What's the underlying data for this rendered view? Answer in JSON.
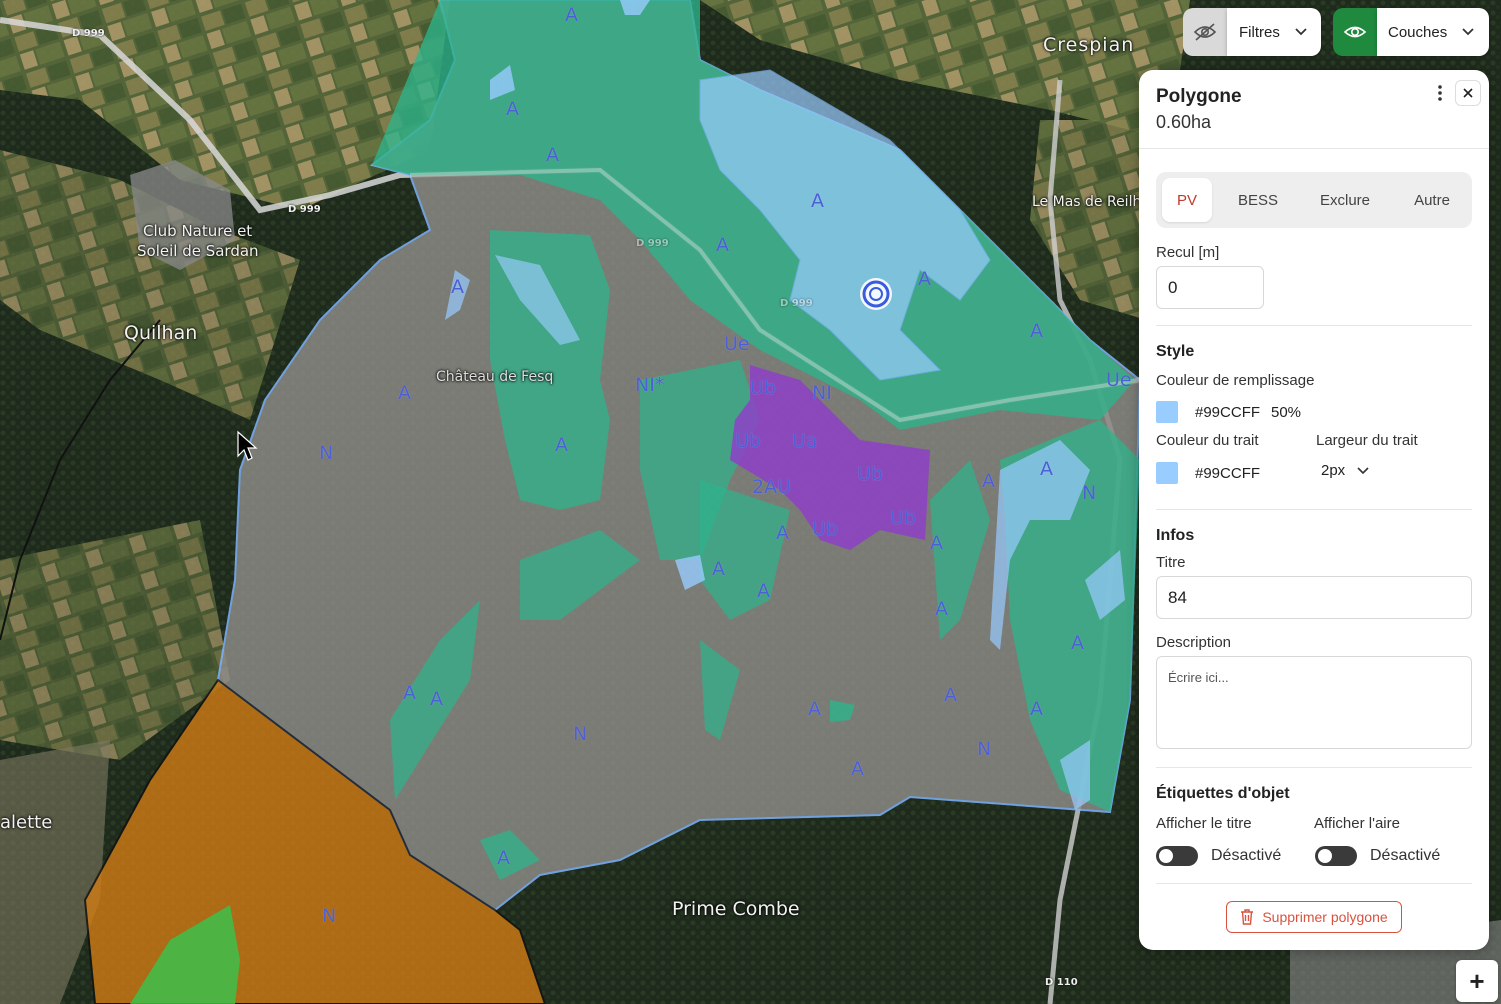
{
  "map": {
    "places": [
      {
        "id": "crespian",
        "name": "Crespian"
      },
      {
        "id": "club",
        "name": "Club Nature et"
      },
      {
        "id": "club2",
        "name": "Soleil de Sardan"
      },
      {
        "id": "quilhan",
        "name": "Quilhan"
      },
      {
        "id": "chateau",
        "name": "Château de Fesq"
      },
      {
        "id": "masreilh",
        "name": "Le Mas de Reilh"
      },
      {
        "id": "primecombe",
        "name": "Prime Combe"
      },
      {
        "id": "alette",
        "name": "alette"
      }
    ],
    "roads": [
      "D 999",
      "D 999",
      "D 999",
      "D 999",
      "D 110"
    ],
    "zones": [
      "A",
      "A",
      "A",
      "A",
      "A",
      "A",
      "A",
      "A",
      "A",
      "A",
      "A",
      "A",
      "A",
      "A",
      "A",
      "A",
      "A",
      "A",
      "A",
      "A",
      "A",
      "A",
      "A",
      "A",
      "N",
      "N",
      "N",
      "N",
      "N",
      "Ue",
      "Ue",
      "NI*",
      "NI",
      "Ub",
      "Ub",
      "Ua",
      "Ub",
      "Ub",
      "2AU",
      "Ub"
    ],
    "colors": {
      "agri": "#2fb48a",
      "natural": "#8a8a8a",
      "urban": "#8e3fc7",
      "drawn_polygon": "#99ccff",
      "orange_zone": "#d17c14",
      "green_zone": "#3cbf4a"
    }
  },
  "toolbar": {
    "filters_label": "Filtres",
    "layers_label": "Couches",
    "filters_visibility_icon": "eye-slash-icon",
    "layers_visibility_icon": "eye-icon"
  },
  "panel": {
    "title": "Polygone",
    "area": "0.60ha",
    "tabs": [
      "PV",
      "BESS",
      "Exclure",
      "Autre"
    ],
    "active_tab": "PV",
    "setback_label": "Recul [m]",
    "setback_value": "0",
    "style_heading": "Style",
    "fill_label": "Couleur de remplissage",
    "fill_color": "#99CCFF",
    "fill_opacity": "50%",
    "stroke_label": "Couleur du trait",
    "stroke_color": "#99CCFF",
    "stroke_width_label": "Largeur du trait",
    "stroke_width_value": "2px",
    "infos_heading": "Infos",
    "title_label": "Titre",
    "title_value": "84",
    "description_label": "Description",
    "description_placeholder": "Écrire ici...",
    "labels_heading": "Étiquettes d'objet",
    "show_title_label": "Afficher le titre",
    "show_title_state": "Désactivé",
    "show_area_label": "Afficher l'aire",
    "show_area_state": "Désactivé",
    "delete_label": "Supprimer polygone"
  },
  "zoom": {
    "plus": "+"
  }
}
